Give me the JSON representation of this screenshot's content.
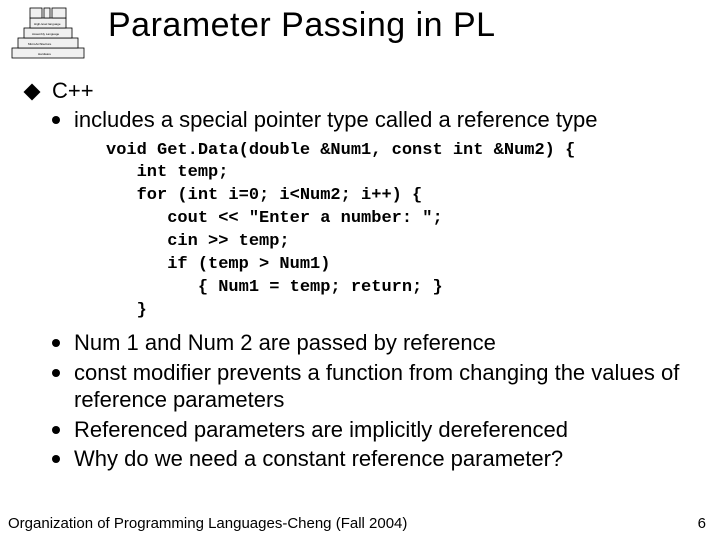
{
  "title": "Parameter Passing in PL",
  "heading": "C++",
  "bullets": {
    "b1": "includes a special pointer type called a reference type",
    "b2": "Num 1 and Num 2 are passed by reference",
    "b3": "const modifier prevents a function from changing the values of reference parameters",
    "b4": "Referenced parameters are implicitly dereferenced",
    "b5": "Why do we need a constant reference parameter?"
  },
  "code": {
    "l1": "void Get.Data(double &Num1, const int &Num2) {",
    "l2": "   int temp;",
    "l3": "   for (int i=0; i<Num2; i++) {",
    "l4": "      cout << \"Enter a number: \";",
    "l5": "      cin >> temp;",
    "l6": "      if (temp > Num1)",
    "l7": "         { Num1 = temp; return; }",
    "l8": "   }"
  },
  "footer": "Organization of Programming Languages-Cheng (Fall 2004)",
  "page": "6"
}
